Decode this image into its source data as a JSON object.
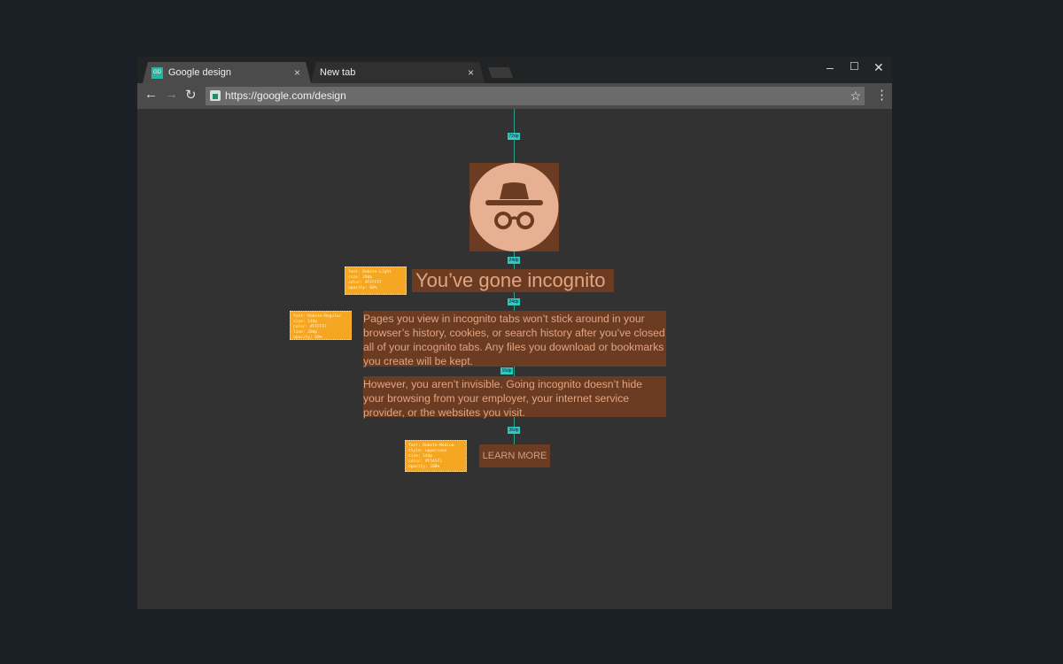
{
  "browser": {
    "tabs": [
      {
        "label": "Google design",
        "favicon": "GD",
        "close": "×"
      },
      {
        "label": "New tab",
        "close": "×"
      }
    ],
    "window_controls": {
      "minimize": "–",
      "maximize": "☐",
      "close": "✕"
    },
    "nav": {
      "back": "←",
      "forward": "→",
      "reload": "↻"
    },
    "url": "https://google.com/design",
    "star": "☆",
    "menu": "⋮"
  },
  "page": {
    "title": "You’ve gone incognito",
    "paragraph1": "Pages you view in incognito tabs won’t stick around in your browser’s history, cookies, or search history after you’ve closed all of your incognito tabs. Any files you download or bookmarks you create will be kept.",
    "paragraph2": "However, you aren’t invisible. Going incognito doesn’t hide your browsing from your employer, your internet service provider, or the websites you visit.",
    "button": "LEARN MORE"
  },
  "spacing_tags": [
    "72dp",
    "24dp",
    "24dp",
    "16dp",
    "16dp",
    "36dp"
  ],
  "annotations": {
    "title": [
      "font: Roboto-Light",
      "size: 28dp",
      "color: #FFFFFF",
      "opacity: 60%"
    ],
    "body": [
      "font: Roboto-Regular",
      "size: 14dp",
      "color: #FFFFFF",
      "line: 20dp",
      "opacity: 60%"
    ],
    "button": [
      "font: Roboto-Medium",
      "style: uppercase",
      "size: 14dp",
      "color: #F5A5F1",
      "opacity: 100%"
    ]
  },
  "colors": {
    "accent": "#f5a623",
    "spacing": "#33c9b7",
    "highlight": "#6b3b22"
  }
}
